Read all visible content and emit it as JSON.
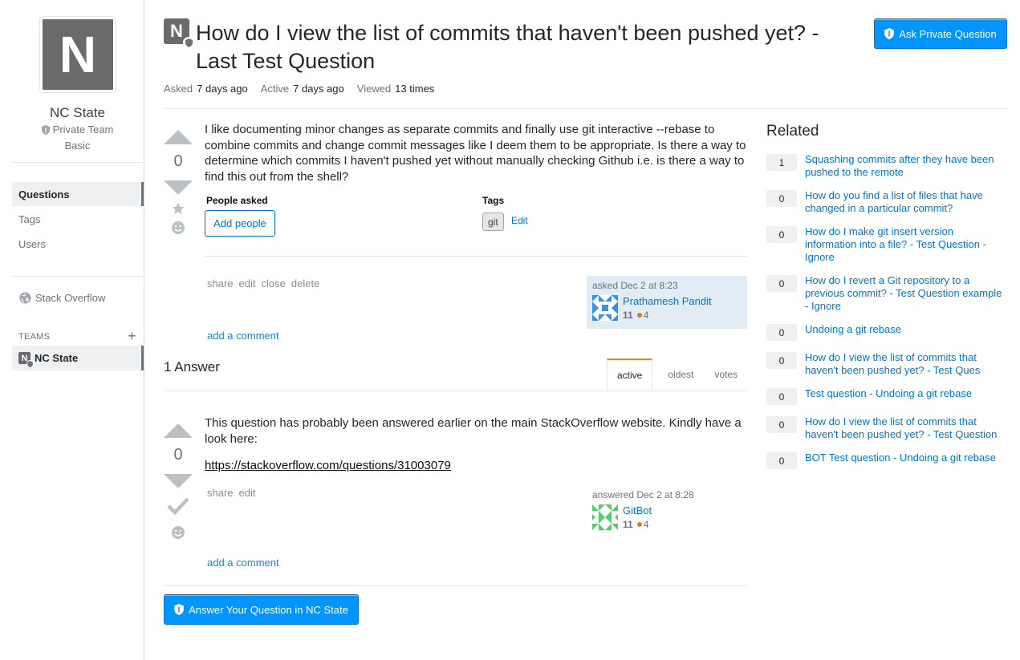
{
  "sidebar": {
    "team_avatar_letter": "N",
    "team_name": "NC State",
    "team_privacy": "Private Team",
    "team_plan": "Basic",
    "nav": [
      {
        "label": "Questions",
        "active": true
      },
      {
        "label": "Tags",
        "active": false
      },
      {
        "label": "Users",
        "active": false
      }
    ],
    "stack_overflow_label": "Stack Overflow",
    "teams_label": "TEAMS",
    "teams_plus": "+",
    "team_item_letter": "N",
    "team_item_label": "NC State"
  },
  "question": {
    "badge_letter": "N",
    "title": "How do I view the list of commits that haven't been pushed yet? - Last Test Question",
    "ask_button": "Ask Private Question",
    "meta": {
      "asked_label": "Asked",
      "asked_value": "7 days ago",
      "active_label": "Active",
      "active_value": "7 days ago",
      "viewed_label": "Viewed",
      "viewed_value": "13 times"
    },
    "votes": "0",
    "body": "I like documenting minor changes as separate commits and finally use git interactive --rebase to combine commits and change commit messages like I deem them to be appropriate. Is there a way to determine which commits I haven't pushed yet without manually checking Github i.e. is there a way to find this out from the shell?",
    "people_label": "People asked",
    "add_people": "Add people",
    "tags_label": "Tags",
    "tags": [
      "git"
    ],
    "tags_edit": "Edit",
    "menu": [
      "share",
      "edit",
      "close",
      "delete"
    ],
    "asked_text": "asked Dec 2 at 8:23",
    "user": {
      "name": "Prathamesh Pandit",
      "rep": "11",
      "bronze": "4"
    },
    "add_comment": "add a comment"
  },
  "answers": {
    "header": "1 Answer",
    "tabs": [
      "active",
      "oldest",
      "votes"
    ],
    "answer": {
      "votes": "0",
      "body": "This question has probably been answered earlier on the main StackOverflow website. Kindly have a look here:",
      "link": "https://stackoverflow.com/questions/31003079",
      "menu": [
        "share",
        "edit"
      ],
      "answered_text": "answered Dec 2 at 8:28",
      "user": {
        "name": "GitBot",
        "rep": "11",
        "bronze": "4"
      },
      "add_comment": "add a comment"
    },
    "answer_button": "Answer Your Question in NC State"
  },
  "related": {
    "title": "Related",
    "items": [
      {
        "score": "1",
        "title": "Squashing commits after they have been pushed to the remote"
      },
      {
        "score": "0",
        "title": "How do you find a list of files that have changed in a particular commit?"
      },
      {
        "score": "0",
        "title": "How do I make git insert version information into a file? - Test Question - Ignore"
      },
      {
        "score": "0",
        "title": "How do I revert a Git repository to a previous commit? - Test Question example - Ignore"
      },
      {
        "score": "0",
        "title": "Undoing a git rebase"
      },
      {
        "score": "0",
        "title": "How do I view the list of commits that haven't been pushed yet? - Test Ques"
      },
      {
        "score": "0",
        "title": "Test question - Undoing a git rebase"
      },
      {
        "score": "0",
        "title": "How do I view the list of commits that haven't been pushed yet? - Test Question"
      },
      {
        "score": "0",
        "title": "BOT Test question - Undoing a git rebase"
      }
    ]
  },
  "colors": {
    "accent_blue": "#0095ff",
    "link_blue": "#0077cc",
    "owner_card_bg": "#e1ecf4",
    "active_tab_border": "#f48024",
    "bronze": "#cd7f32"
  }
}
